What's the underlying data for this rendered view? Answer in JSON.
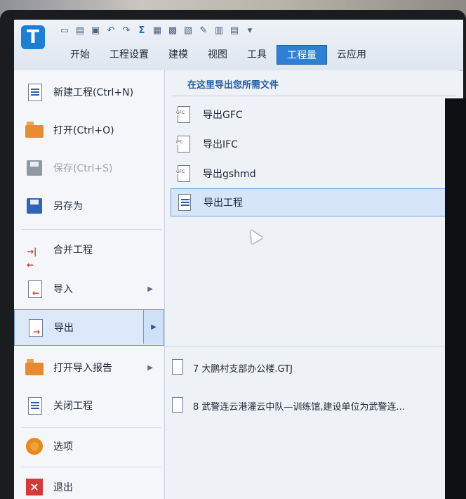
{
  "ribbon": {
    "tabs": [
      {
        "label": "开始"
      },
      {
        "label": "工程设置"
      },
      {
        "label": "建模"
      },
      {
        "label": "视图"
      },
      {
        "label": "工具"
      },
      {
        "label": "工程量"
      },
      {
        "label": "云应用"
      }
    ],
    "active_tab": "工程量",
    "quick_access_icons": [
      "new-doc-icon",
      "open-icon",
      "save-icon",
      "undo-icon",
      "redo-icon",
      "sigma-icon",
      "report-icon",
      "calc-icon",
      "check-icon",
      "edit-icon",
      "grid-icon",
      "export-icon",
      "dropdown-icon"
    ],
    "app_logo_text": "T"
  },
  "file_menu": {
    "items": [
      {
        "label": "新建工程(Ctrl+N)",
        "icon": "new-project-icon"
      },
      {
        "label": "打开(Ctrl+O)",
        "icon": "open-folder-icon"
      },
      {
        "label": "保存(Ctrl+S)",
        "icon": "save-icon",
        "disabled": true
      },
      {
        "label": "另存为",
        "icon": "save-as-icon"
      },
      {
        "label": "合并工程",
        "icon": "merge-icon"
      },
      {
        "label": "导入",
        "icon": "import-icon",
        "has_submenu": true
      },
      {
        "label": "导出",
        "icon": "export-icon",
        "has_submenu": true,
        "selected": true
      },
      {
        "label": "打开导入报告",
        "icon": "import-report-icon",
        "has_submenu": true
      },
      {
        "label": "关闭工程",
        "icon": "close-project-icon"
      },
      {
        "label": "选项",
        "icon": "options-gear-icon"
      },
      {
        "label": "退出",
        "icon": "exit-icon"
      }
    ]
  },
  "export_panel": {
    "title": "在这里导出您所需文件",
    "items": [
      {
        "label": "导出GFC",
        "tag": "GFC"
      },
      {
        "label": "导出IFC",
        "tag": "IFC"
      },
      {
        "label": "导出gshmd",
        "tag": "GFC"
      },
      {
        "label": "导出工程",
        "tag": ""
      }
    ],
    "hovered_item": "导出工程"
  },
  "recent_files": [
    {
      "label": "7 大鹏村支部办公楼.GTJ"
    },
    {
      "label": "8 武警连云港灌云中队—训练馆,建设单位为武警连..."
    }
  ],
  "colors": {
    "accent": "#2f7fd6",
    "selection_bg": "#dce9f8",
    "selection_border": "#6e9fd6",
    "panel_title": "#1f5ea8"
  }
}
